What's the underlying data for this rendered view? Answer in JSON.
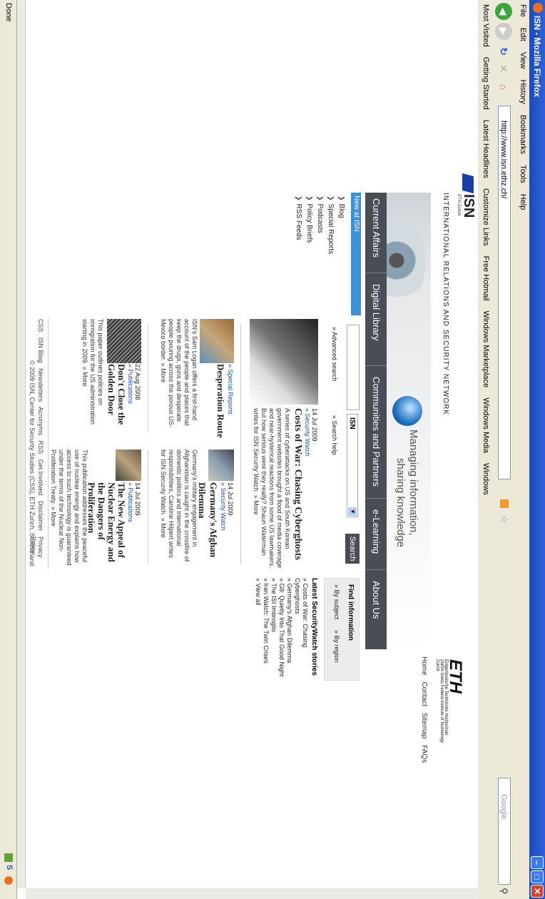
{
  "window": {
    "title": "ISN - Mozilla Firefox"
  },
  "menu": [
    "File",
    "Edit",
    "View",
    "History",
    "Bookmarks",
    "Tools",
    "Help"
  ],
  "nav": {
    "url": "http://www.isn.ethz.ch/",
    "search_engine": "Google"
  },
  "bookmarks": [
    "Most Visited",
    "Getting Started",
    "Latest Headlines",
    "Customize Links",
    "Free Hotmail",
    "Windows Marketplace",
    "Windows Media",
    "Windows"
  ],
  "header": {
    "logo": "ISN",
    "logo_sub": "ETH Zurich",
    "site_title": "INTERNATIONAL RELATIONS AND SECURITY NETWORK",
    "eth_logo": "ETH",
    "eth_sub": "Eidgenössische Technische Hochschule Zürich Swiss Federal Institute of Technology Zurich",
    "top_links": [
      "Home",
      "Contact",
      "Sitemap",
      "FAQs"
    ],
    "tagline_1": "Managing information,",
    "tagline_2": "sharing knowledge"
  },
  "main_nav": [
    "Current Affairs",
    "Digital Library",
    "Communities and Partners",
    "e-Learning",
    "About Us"
  ],
  "left_nav": {
    "header": "New at ISN",
    "items": [
      "Blog",
      "Special Reports",
      "Podcasts",
      "Policy Briefs",
      "RSS Feeds"
    ]
  },
  "search": {
    "select_value": "ISN",
    "button": "Search",
    "advanced": "Advanced search",
    "help": "Search help"
  },
  "find": {
    "title": "Find information",
    "by_subject": "By subject",
    "by_region": "By region"
  },
  "latest": {
    "title": "Latest SecurityWatch stories",
    "items": [
      "Costs of War: Chasing Cyberghosts",
      "Germany's Afghan Dilemma",
      "G8: Quietly Into That Good Night",
      "The ISI Imbroglio",
      "Iran Watch: The Twin Crises",
      "View all"
    ]
  },
  "feature": {
    "date": "14 Jul 2009",
    "section": "Security Watch",
    "headline": "Costs of War: Chasing Cyberghosts",
    "body": "A series of cyberattacks on US and South Korean government websites brought a flood of media coverage and near-hysterical reactions from some US lawmakers. But how serious were they really? Shaun Waterman writes for ISN Security Watch.",
    "more": "More"
  },
  "story1": {
    "section": "Special Reports",
    "headline": "Desperation Route",
    "body": "ISN's Sam Logan offers a first-hand account of the people and places that keep the drugs, guns and desperate people pouring across the porous US-Mexico border.",
    "more": "More"
  },
  "story2": {
    "date": "14 Jul 2009",
    "section": "Security Watch",
    "headline": "Germany's Afghan Dilemma",
    "body": "Germany's military engagement in Afghanistan is caught in the crossfire of domestic politics and international responsibilities, Caroline Hilpert writes for ISN Security Watch.",
    "more": "More"
  },
  "story3": {
    "date": "22 Aug 2008",
    "section": "Publications",
    "headline": "Don't Close the Golden Door",
    "body": "This paper outlines policies on immigration for the US administration starting in 2009.",
    "more": "More"
  },
  "story4": {
    "date": "14 Jul 2009",
    "section": "Publications",
    "headline": "The New Appeal of Nuclear Energy and the Dangers of Proliferation",
    "body": "This publication addresses the peaceful use of nuclear energy and explains how access to such technology is guaranteed under the terms of the Nuclear Non-Proliferation Treaty.",
    "more": "More"
  },
  "footer": {
    "links": [
      "CSS",
      "ISN Blog",
      "Newsletters",
      "Acronyms",
      "RSS",
      "Get Involved",
      "Disclaimer",
      "Privacy Policy"
    ],
    "copyright": "© 2009 ISN, Center for Security Studies (CSS), ETH Zurich, Switzerland"
  },
  "status": {
    "text": "Done"
  }
}
